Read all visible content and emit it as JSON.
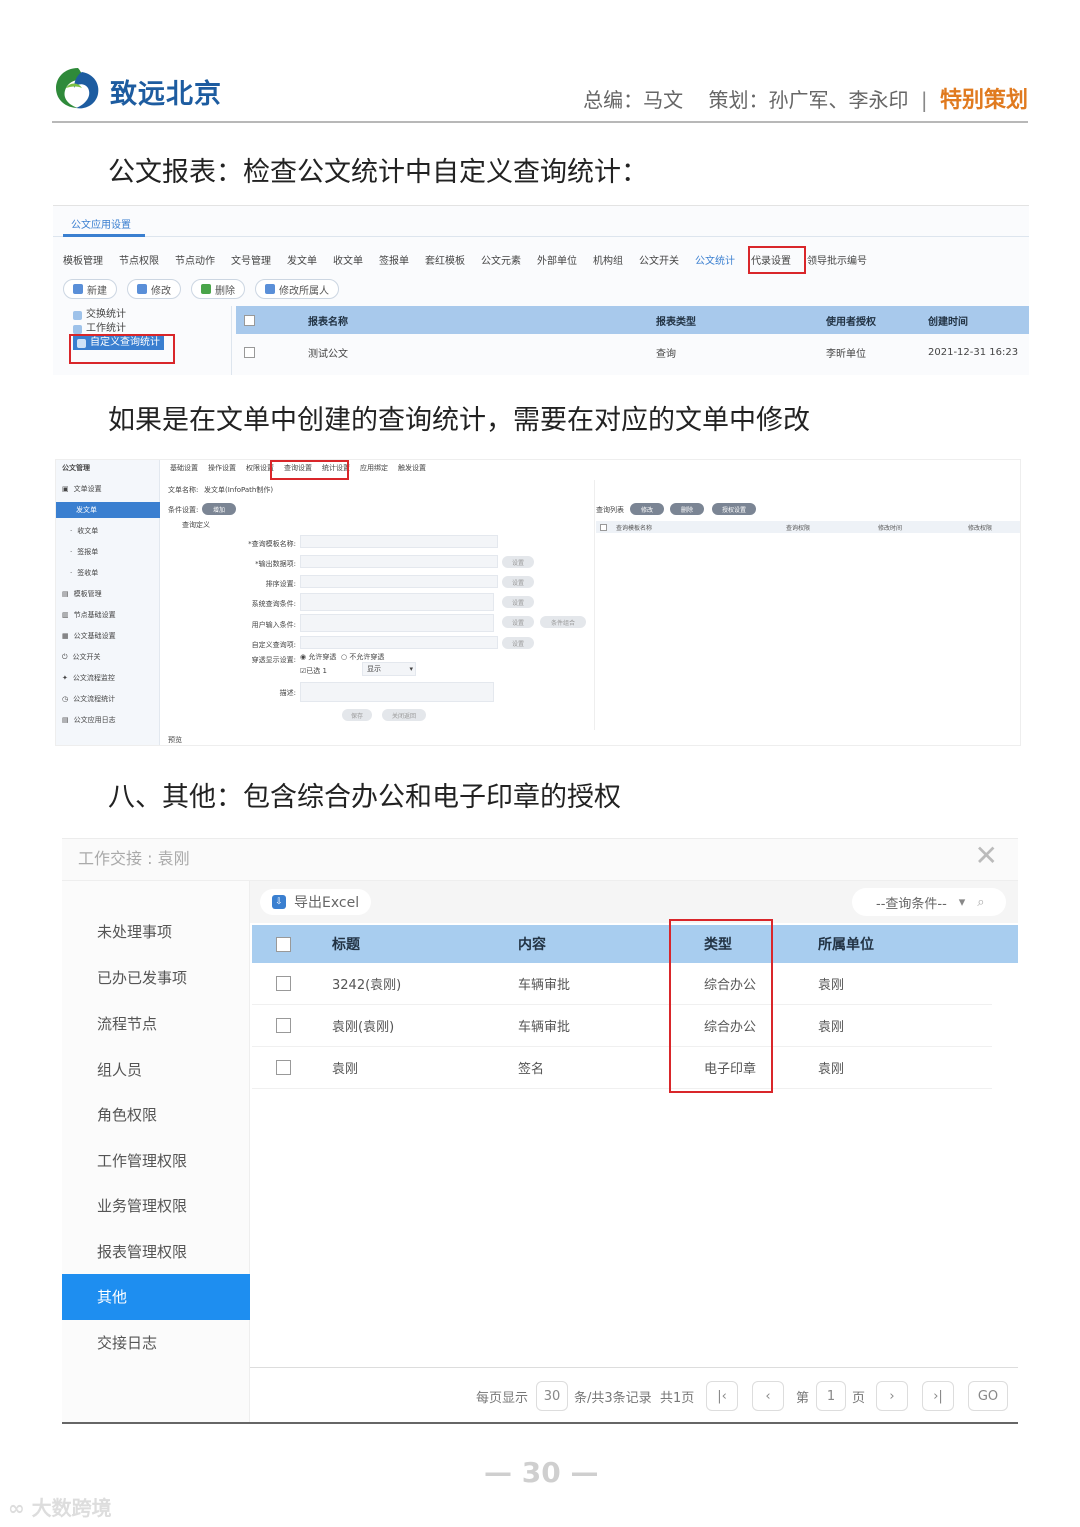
{
  "header": {
    "logo_text": "致远北京",
    "editor": "总编：马文",
    "planner": "策划：孙广军、李永印",
    "special": "特别策划"
  },
  "paragraphs": {
    "p1": "公文报表：检查公文统计中自定义查询统计：",
    "p2": "如果是在文单中创建的查询统计，需要在对应的文单中修改",
    "p3": "八、其他：包含综合办公和电子印章的授权"
  },
  "shot1": {
    "title": "公文应用设置",
    "tabs": [
      "模板管理",
      "节点权限",
      "节点动作",
      "文号管理",
      "发文单",
      "收文单",
      "签报单",
      "套红模板",
      "公文元素",
      "外部单位",
      "机构组",
      "公文开关",
      "公文统计",
      "代录设置",
      "领导批示编号"
    ],
    "selected_tab": "公文统计",
    "toolbar": [
      "新建",
      "修改",
      "删除",
      "修改所属人"
    ],
    "tree": [
      "交换统计",
      "工作统计",
      "自定义查询统计"
    ],
    "columns": [
      "报表名称",
      "报表类型",
      "使用者授权",
      "创建时间"
    ],
    "rows": [
      [
        "测试公文",
        "查询",
        "李昕单位",
        "2021-12-31 16:23"
      ]
    ]
  },
  "shot2": {
    "sidebar_title": "公文管理",
    "sidebar": [
      "文单设置",
      "发文单",
      "收文单",
      "签报单",
      "签收单",
      "模板管理",
      "节点基础设置",
      "公文基础设置",
      "公文开关",
      "公文流程监控",
      "公文流程统计",
      "公文应用日志"
    ],
    "tabs": [
      "基础设置",
      "操作设置",
      "权限设置",
      "查询设置",
      "统计设置",
      "应用绑定",
      "触发设置"
    ],
    "form_name_label": "文单名称:",
    "form_name_value": "发文单(InfoPath制作)",
    "cond_label": "条件设置:",
    "add_btn": "增加",
    "section": "查询定义",
    "fields": [
      "*查询模板名称:",
      "*输出数据项:",
      "排序设置:",
      "系统查询条件:",
      "用户输入条件:",
      "自定义查询项:",
      "穿透显示设置:",
      "描述:"
    ],
    "set_btn": "设置",
    "clear_btn": "条件组合",
    "radio1": "允许穿透",
    "radio2": "不允许穿透",
    "chk": "已选 1",
    "select_val": "显示",
    "save": "保存",
    "cancel": "关闭返回",
    "bottom": "预览",
    "right_label": "查询列表",
    "right_btns": [
      "修改",
      "删除",
      "授权设置"
    ],
    "right_cols": [
      "查询模板名称",
      "查询权限",
      "修改时间",
      "修改权限"
    ]
  },
  "shot3": {
    "title": "工作交接 : 袁刚",
    "nav": [
      "未处理事项",
      "已办已发事项",
      "流程节点",
      "组人员",
      "角色权限",
      "工作管理权限",
      "业务管理权限",
      "报表管理权限",
      "其他",
      "交接日志"
    ],
    "selected_nav": "其他",
    "export": "导出Excel",
    "query": "--查询条件--",
    "columns": [
      "标题",
      "内容",
      "类型",
      "所属单位"
    ],
    "rows": [
      [
        "3242(袁刚)",
        "车辆审批",
        "综合办公",
        "袁刚"
      ],
      [
        "袁刚(袁刚)",
        "车辆审批",
        "综合办公",
        "袁刚"
      ],
      [
        "袁刚",
        "签名",
        "电子印章",
        "袁刚"
      ]
    ],
    "pager": {
      "per_page_label": "每页显示",
      "per_page": "30",
      "total": "条/共3条记录",
      "pages": "共1页",
      "page_pre": "第",
      "page": "1",
      "page_post": "页",
      "go": "GO"
    }
  },
  "footer": {
    "page_number": "30",
    "watermark": "大数跨境"
  },
  "colors": {
    "brand_blue": "#1d5ca0",
    "accent_orange": "#e07a1f",
    "highlight_red": "#d9262a",
    "selected_blue": "#1e8ef0"
  }
}
